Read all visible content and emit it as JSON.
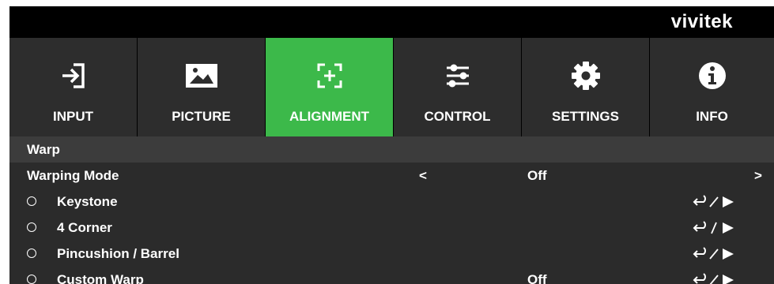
{
  "brand": "vivitek",
  "tabs": [
    {
      "label": "INPUT",
      "icon": "input-icon",
      "active": false
    },
    {
      "label": "PICTURE",
      "icon": "picture-icon",
      "active": false
    },
    {
      "label": "ALIGNMENT",
      "icon": "alignment-icon",
      "active": true
    },
    {
      "label": "CONTROL",
      "icon": "sliders-icon",
      "active": false
    },
    {
      "label": "SETTINGS",
      "icon": "gear-icon",
      "active": false
    },
    {
      "label": "INFO",
      "icon": "info-icon",
      "active": false
    }
  ],
  "section": {
    "title": "Warp"
  },
  "warping_mode": {
    "label": "Warping Mode",
    "left_arrow": "<",
    "value": "Off",
    "right_arrow": ">"
  },
  "options": [
    {
      "label": "Keystone",
      "value": "",
      "selected": false
    },
    {
      "label": "4 Corner",
      "value": "",
      "selected": false
    },
    {
      "label": "Pincushion / Barrel",
      "value": "",
      "selected": false
    },
    {
      "label": "Custom Warp",
      "value": "Off",
      "selected": false
    }
  ],
  "colors": {
    "active_tab": "#3cb94a",
    "tab_bg": "#2d2d2d",
    "panel_bg": "#2b2b2b",
    "section_bg": "#3c3c3c",
    "text": "#ffffff"
  }
}
